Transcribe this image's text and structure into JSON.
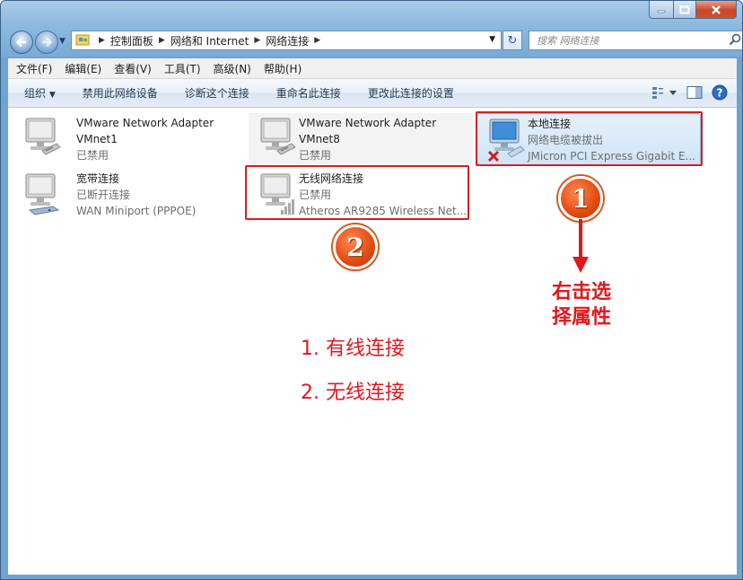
{
  "window": {
    "caption_buttons": [
      "minimize-icon",
      "maximize-icon",
      "close-icon"
    ]
  },
  "nav": {
    "breadcrumbs": [
      "控制面板",
      "网络和 Internet",
      "网络连接"
    ],
    "search_placeholder": "搜索 网络连接"
  },
  "menu": [
    "文件(F)",
    "编辑(E)",
    "查看(V)",
    "工具(T)",
    "高级(N)",
    "帮助(H)"
  ],
  "toolbar": {
    "organize": "组织",
    "disable": "禁用此网络设备",
    "diagnose": "诊断这个连接",
    "rename": "重命名此连接",
    "change_settings": "更改此连接的设置"
  },
  "connections": [
    {
      "name": "VMware Network Adapter",
      "line2": "VMnet1",
      "line3": "已禁用"
    },
    {
      "name": "VMware Network Adapter",
      "line2": "VMnet8",
      "line3": "已禁用"
    },
    {
      "name": "本地连接",
      "line2": "网络电缆被拔出",
      "line3": "JMicron PCI Express Gigabit E..."
    },
    {
      "name": "宽带连接",
      "line2": "已断开连接",
      "line3": "WAN Miniport (PPPOE)"
    },
    {
      "name": "无线网络连接",
      "line2": "已禁用",
      "line3": "Atheros AR9285 Wireless Net..."
    }
  ],
  "annotations": {
    "badge1": "1",
    "badge2": "2",
    "right_click_line1": "右击选",
    "right_click_line2": "择属性",
    "note1": "1. 有线连接",
    "note2": "2. 无线连接",
    "color": "#e0181d"
  }
}
